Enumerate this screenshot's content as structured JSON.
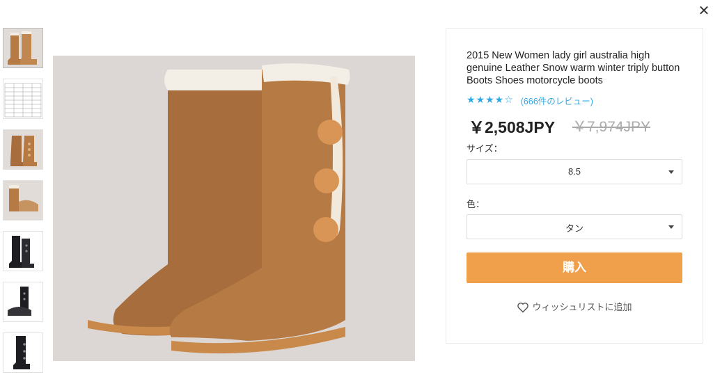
{
  "close": {
    "glyph": "✕"
  },
  "thumbnails": [
    {
      "name": "thumb-boots-tan-pair",
      "active": true
    },
    {
      "name": "thumb-size-chart"
    },
    {
      "name": "thumb-boots-tan-front"
    },
    {
      "name": "thumb-boots-tan-sole"
    },
    {
      "name": "thumb-boots-black-pair"
    },
    {
      "name": "thumb-boots-black-sole"
    },
    {
      "name": "thumb-boots-black-side"
    }
  ],
  "product": {
    "title": "2015 New Women lady girl australia high genuine Leather Snow warm winter triply button Boots Shoes motorcycle boots",
    "stars": "★★★★☆",
    "rating": 4,
    "reviews": "(666件のレビュー)",
    "price": "￥2,508JPY",
    "old_price": "￥7,974JPY"
  },
  "size": {
    "label": "サイズ：",
    "value": "8.5"
  },
  "color": {
    "label": "色：",
    "value": "タン"
  },
  "buy_label": "購入",
  "wishlist_label": "ウィッシュリストに追加",
  "colors": {
    "accent": "#f0a04b",
    "star": "#2ea8e5",
    "boot": "#b67a45"
  }
}
